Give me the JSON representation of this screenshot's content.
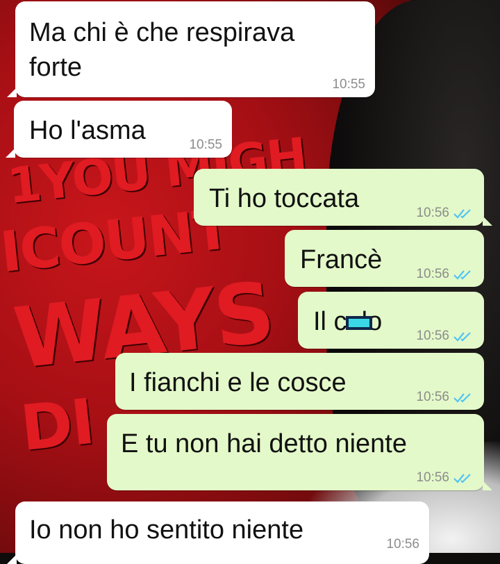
{
  "colors": {
    "incoming_bubble": "#ffffff",
    "outgoing_bubble": "#e3f9c9",
    "timestamp": "#8c8c8c",
    "read_ticks": "#4fc3f7"
  },
  "messages": [
    {
      "direction": "incoming",
      "text": "Ma chi è che respirava\nforte",
      "time": "10:55"
    },
    {
      "direction": "incoming",
      "text": "Ho l'asma",
      "time": "10:55"
    },
    {
      "direction": "outgoing",
      "text": "Ti ho toccata",
      "time": "10:56",
      "status_icon": "double-check-icon"
    },
    {
      "direction": "outgoing",
      "text": "Francè",
      "time": "10:56",
      "status_icon": "double-check-icon"
    },
    {
      "direction": "outgoing",
      "text": "Il c  lo",
      "time": "10:56",
      "status_icon": "double-check-icon",
      "censored": true
    },
    {
      "direction": "outgoing",
      "text": "I fianchi e le cosce",
      "time": "10:56",
      "status_icon": "double-check-icon"
    },
    {
      "direction": "outgoing",
      "text": "E tu non hai detto niente",
      "time": "10:56",
      "status_icon": "double-check-icon"
    },
    {
      "direction": "incoming",
      "text": "Io non ho sentito niente",
      "time": "10:56"
    }
  ]
}
